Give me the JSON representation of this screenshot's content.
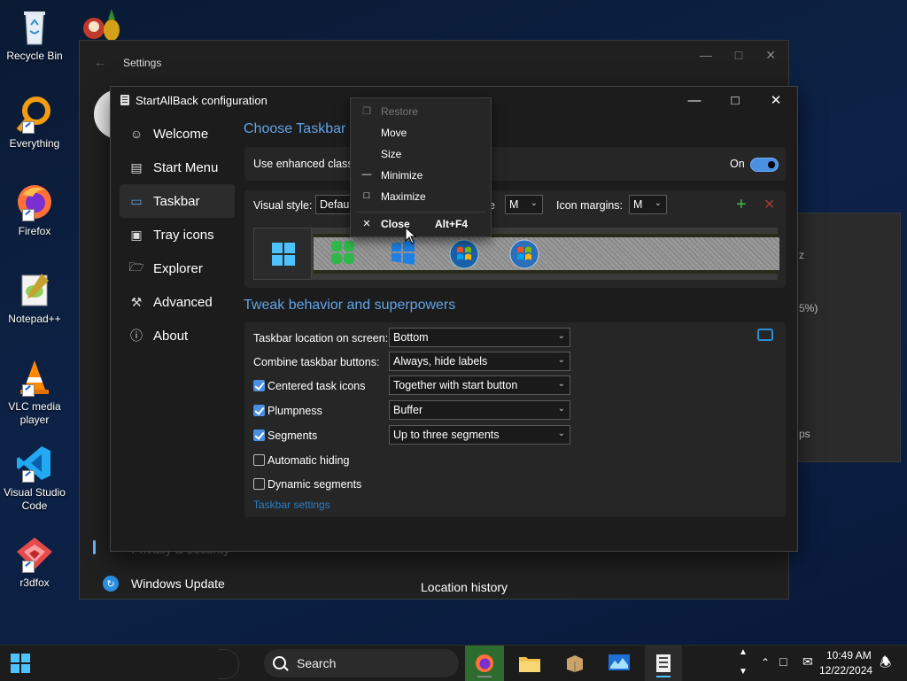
{
  "desktop": {
    "icons": [
      {
        "label": "Recycle Bin"
      },
      {
        "label": "Everything"
      },
      {
        "label": "Firefox"
      },
      {
        "label": "Notepad++"
      },
      {
        "label": "VLC media player"
      },
      {
        "label": "Visual Studio Code"
      },
      {
        "label": "r3dfox"
      }
    ]
  },
  "settings_window": {
    "title": "Settings",
    "nav_partial": "Privacy & security",
    "windows_update": "Windows Update",
    "location_history": "Location history",
    "panel_texts": [
      "z",
      "5%)",
      "ps"
    ]
  },
  "sab": {
    "title": "StartAllBack configuration",
    "nav": [
      {
        "label": "Welcome",
        "icon": "smiley-icon"
      },
      {
        "label": "Start Menu",
        "icon": "start-menu-icon"
      },
      {
        "label": "Taskbar",
        "icon": "taskbar-icon"
      },
      {
        "label": "Tray icons",
        "icon": "tray-icon"
      },
      {
        "label": "Explorer",
        "icon": "folder-icon"
      },
      {
        "label": "Advanced",
        "icon": "wrench-icon"
      },
      {
        "label": "About",
        "icon": "info-icon"
      }
    ],
    "section1_title": "Choose Taskbar s",
    "enhanced_label": "Use enhanced classic",
    "toggle_state": "On",
    "visual_style_label": "Visual style:",
    "visual_style_value": "Defaul",
    "size_label_tail": "e",
    "size_value": "M",
    "icon_margins_label": "Icon margins:",
    "icon_margins_value": "M",
    "section2_title": "Tweak behavior and superpowers",
    "location_label": "Taskbar location on screen:",
    "location_value": "Bottom",
    "combine_label": "Combine taskbar buttons:",
    "combine_value": "Always, hide labels",
    "centered_label": "Centered task icons",
    "centered_value": "Together with start button",
    "plumpness_label": "Plumpness",
    "plumpness_value": "Buffer",
    "segments_label": "Segments",
    "segments_value": "Up to three segments",
    "autohide_label": "Automatic hiding",
    "dynamic_label": "Dynamic segments",
    "taskbar_settings_link": "Taskbar settings",
    "checks": {
      "centered": true,
      "plumpness": true,
      "segments": true,
      "autohide": false,
      "dynamic": false
    }
  },
  "context_menu": {
    "items": [
      {
        "label": "Restore",
        "enabled": false
      },
      {
        "label": "Move",
        "enabled": true
      },
      {
        "label": "Size",
        "enabled": true
      },
      {
        "label": "Minimize",
        "enabled": true
      },
      {
        "label": "Maximize",
        "enabled": true
      }
    ],
    "close_label": "Close",
    "close_shortcut": "Alt+F4"
  },
  "taskbar": {
    "search_placeholder": "Search",
    "time": "10:49 AM",
    "date": "12/22/2024"
  },
  "colors": {
    "accent": "#4a90e0",
    "link": "#60a5e8",
    "add": "#3dbb4a",
    "remove": "#a03a3a"
  }
}
